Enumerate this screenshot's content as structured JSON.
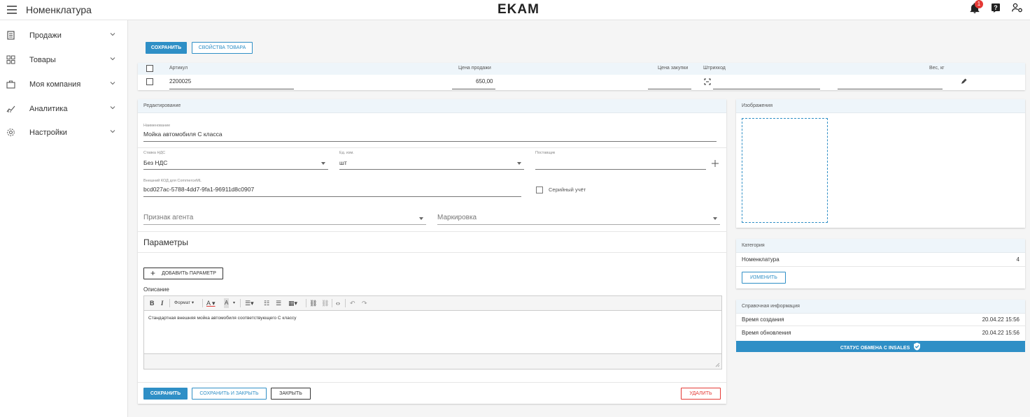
{
  "header": {
    "title": "Номенклатура",
    "logo": "EKAM",
    "notification_count": "1"
  },
  "sidebar": {
    "items": [
      {
        "label": "Продажи",
        "icon": "receipt-icon"
      },
      {
        "label": "Товары",
        "icon": "grid-icon"
      },
      {
        "label": "Моя компания",
        "icon": "briefcase-icon"
      },
      {
        "label": "Аналитика",
        "icon": "chart-icon"
      },
      {
        "label": "Настройки",
        "icon": "gear-icon"
      }
    ]
  },
  "actions_top": {
    "save": "СОХРАНИТЬ",
    "properties": "СВОЙСТВА ТОВАРА"
  },
  "table": {
    "headers": {
      "article": "Артикул",
      "sale_price": "Цена продажи",
      "purchase_price": "Цена закупки",
      "barcode": "Штрихкод",
      "weight": "Вес, кг"
    },
    "row": {
      "article": "2200025",
      "sale_price": "650,00",
      "purchase_price": "",
      "barcode": "",
      "weight": ""
    }
  },
  "edit": {
    "section_title": "Редактирование",
    "name_label": "Наименование",
    "name_value": "Мойка автомобиля С класса",
    "vat_label": "Ставка НДС",
    "vat_value": "Без НДС",
    "unit_label": "Ед. изм.",
    "unit_value": "шт",
    "supplier_label": "Поставщик",
    "supplier_value": "",
    "external_code_label": "Внешний КОД для CommerceML",
    "external_code_value": "bcd027ac-5788-4dd7-9fa1-96911d8c0907",
    "serial_label": "Серийный учёт",
    "agent_placeholder": "Признак агента",
    "marking_placeholder": "Маркировка",
    "params_title": "Параметры",
    "add_param": "ДОБАВИТЬ ПАРАМЕТР",
    "description_label": "Описание",
    "format_label": "Формат",
    "description_text": "Стандартная внешняя мойка автомобиля соответствующего С классу"
  },
  "footer_actions": {
    "save": "СОХРАНИТЬ",
    "save_close": "СОХРАНИТЬ И ЗАКРЫТЬ",
    "close": "ЗАКРЫТЬ",
    "delete": "УДАЛИТЬ"
  },
  "images": {
    "title": "Изображения"
  },
  "category": {
    "title": "Категория",
    "name": "Номенклатура",
    "count": "4",
    "change": "ИЗМЕНИТЬ"
  },
  "reference": {
    "title": "Справочная информация",
    "created_label": "Время создания",
    "created_value": "20.04.22 15:56",
    "updated_label": "Время обновления",
    "updated_value": "20.04.22 15:56",
    "exchange_status": "СТАТУС ОБМЕНА С INSALES"
  },
  "colors": {
    "accent": "#2f8fc6",
    "danger": "#e53935",
    "header_bg": "#eef5fa"
  }
}
